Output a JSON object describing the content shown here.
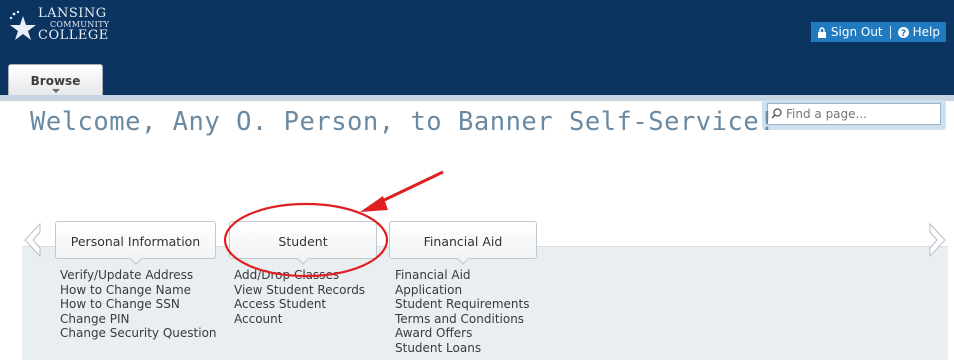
{
  "header": {
    "logo": {
      "line1": "LANSING",
      "line2": "COMMUNITY",
      "line3": "COLLEGE"
    },
    "sign_out": "Sign Out",
    "help": "Help"
  },
  "browse": {
    "label": "Browse"
  },
  "search": {
    "placeholder": "Find a page..."
  },
  "welcome": "Welcome, Any O. Person, to Banner Self-Service!",
  "tabs": [
    {
      "label": "Personal Information",
      "links": [
        "Verify/Update Address",
        "How to Change Name",
        "How to Change SSN",
        "Change PIN",
        "Change Security Question"
      ]
    },
    {
      "label": "Student",
      "links": [
        "Add/Drop Classes",
        "View Student Records",
        "Access Student",
        "Account"
      ]
    },
    {
      "label": "Financial Aid",
      "links": [
        "Financial Aid",
        "Application",
        "Student Requirements",
        "Terms and Conditions",
        "Award Offers",
        "Student Loans"
      ]
    }
  ],
  "colors": {
    "header": "#0b3461",
    "accent": "#1f7ac0",
    "annotation": "#e02020"
  },
  "icons": [
    "star-logo-icon",
    "lock-icon",
    "help-circle-icon",
    "search-icon",
    "chevron-down-icon",
    "left-arrow-icon",
    "right-arrow-icon"
  ]
}
